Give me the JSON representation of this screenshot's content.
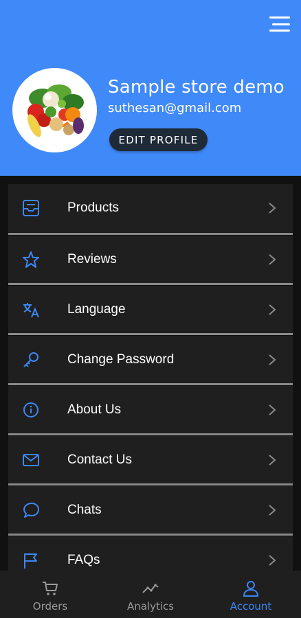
{
  "header": {
    "store_name": "Sample store demo",
    "email": "suthesan@gmail.com",
    "edit_profile_label": "EDIT PROFILE",
    "menu_icon": "hamburger-menu-icon",
    "background_color": "#4089f8"
  },
  "menu": {
    "items": [
      {
        "label": "Products",
        "icon": "inbox-tray-icon"
      },
      {
        "label": "Reviews",
        "icon": "star-icon"
      },
      {
        "label": "Language",
        "icon": "translate-icon"
      },
      {
        "label": "Change Password",
        "icon": "key-icon"
      },
      {
        "label": "About Us",
        "icon": "info-circle-icon"
      },
      {
        "label": "Contact Us",
        "icon": "envelope-icon"
      },
      {
        "label": "Chats",
        "icon": "chat-bubble-icon"
      },
      {
        "label": "FAQs",
        "icon": "flag-icon"
      }
    ],
    "icon_color": "#3d87f5"
  },
  "bottom_nav": {
    "items": [
      {
        "label": "Orders",
        "icon": "cart-icon",
        "active": false
      },
      {
        "label": "Analytics",
        "icon": "trend-line-icon",
        "active": false
      },
      {
        "label": "Account",
        "icon": "person-icon",
        "active": true
      }
    ],
    "active_color": "#3d87f5",
    "inactive_color": "#9a9a9a"
  }
}
